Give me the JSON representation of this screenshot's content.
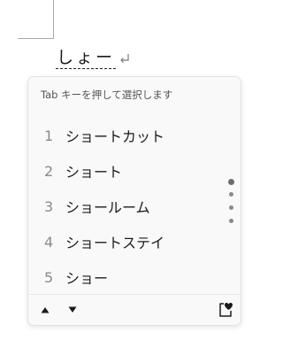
{
  "document": {
    "composition_text": "しょー"
  },
  "ime_panel": {
    "hint": "Tab キーを押して選択します",
    "candidates": [
      {
        "number": "1",
        "text": "ショートカット"
      },
      {
        "number": "2",
        "text": "ショート"
      },
      {
        "number": "3",
        "text": "ショールーム"
      },
      {
        "number": "4",
        "text": "ショートステイ"
      },
      {
        "number": "5",
        "text": "ショー"
      }
    ],
    "page_indicator": {
      "pages": 4,
      "current": 1
    },
    "footer": {
      "up_icon": "triangle-up-icon",
      "down_icon": "triangle-down-icon",
      "favorite_icon": "heart-clipboard-icon"
    }
  }
}
